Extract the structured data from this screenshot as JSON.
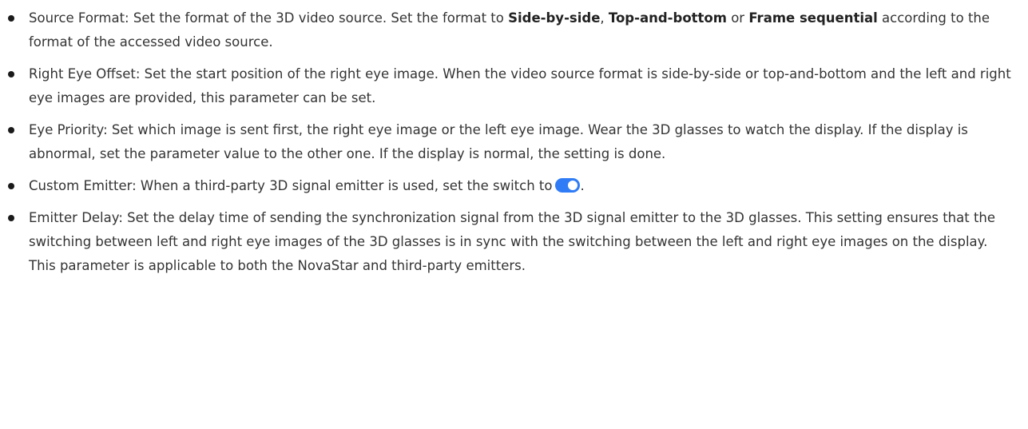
{
  "items": [
    {
      "text_a": "Source Format: Set the format of the 3D video source. Set the format to ",
      "kw1": "Side-by-side",
      "sep1": ", ",
      "kw2": "Top-and-bottom",
      "sep2": " or ",
      "kw3": "Frame sequential",
      "text_b": " according to the format of the accessed video source."
    },
    {
      "text": "Right Eye Offset: Set the start position of the right eye image. When the video source format is side-by-side or top-and-bottom and the left and right eye images are provided, this parameter can be set."
    },
    {
      "text": "Eye Priority: Set which image is sent first, the right eye image or the left eye image. Wear the 3D glasses to watch the display. If the display is abnormal, set the parameter value to the other one. If the display is normal, the setting is done."
    },
    {
      "text_a": "Custom Emitter: When a third-party 3D signal emitter is used, set the switch to",
      "text_b": "."
    },
    {
      "text": "Emitter Delay: Set the delay time of sending the synchronization signal from the 3D signal emitter to the 3D glasses. This setting ensures that the switching between left and right eye images of the 3D glasses is in sync with the switching between the left and right eye images on the display. This parameter is applicable to both the NovaStar and third-party emitters."
    }
  ],
  "colors": {
    "text": "#333333",
    "toggle_on": "#2f7cf6",
    "bullet": "#1a1a1a"
  },
  "icons": {
    "toggle": "toggle-switch-on-icon"
  }
}
